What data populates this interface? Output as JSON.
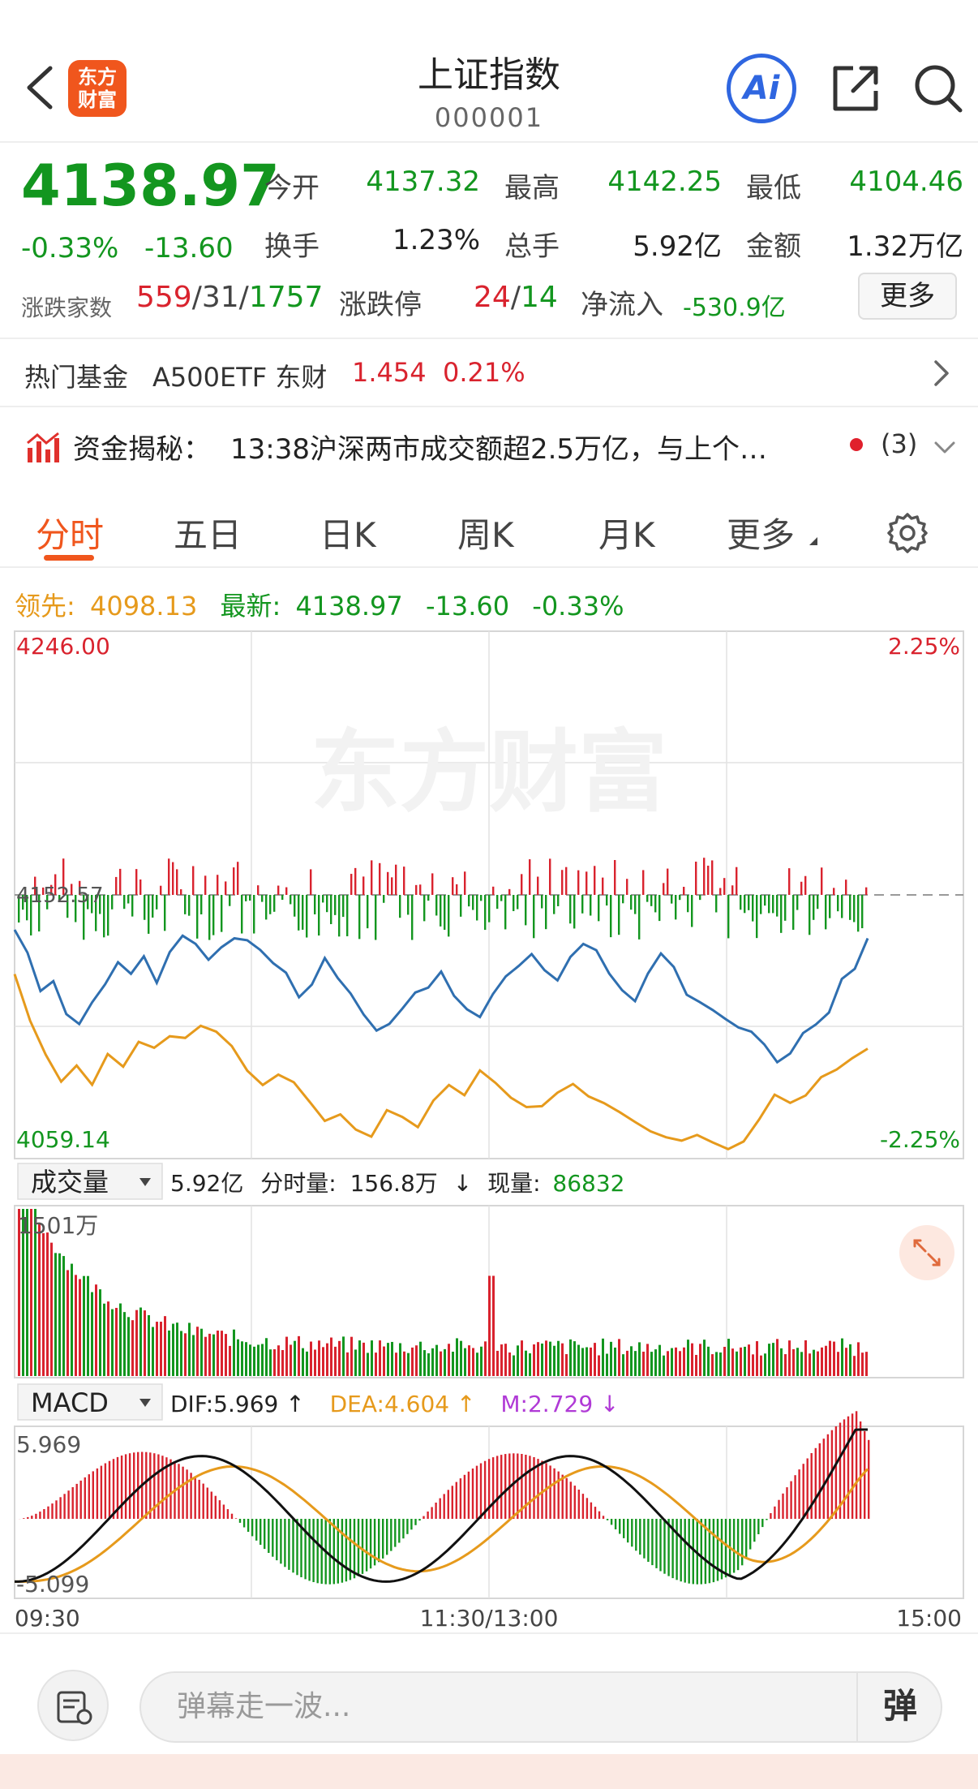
{
  "header": {
    "title": "上证指数",
    "code": "000001",
    "logo_text": "东方财富",
    "ai_label": "Ai"
  },
  "quote": {
    "price": "4138.97",
    "change_pct": "-0.33%",
    "change": "-13.60",
    "open_label": "今开",
    "open": "4137.32",
    "high_label": "最高",
    "high": "4142.25",
    "low_label": "最低",
    "low": "4104.46",
    "turnover_label": "换手",
    "turnover": "1.23%",
    "volume_label": "总手",
    "volume": "5.92亿",
    "amount_label": "金额",
    "amount": "1.32万亿",
    "breadth_label": "涨跌家数",
    "breadth_up": "559",
    "breadth_flat": "31",
    "breadth_down": "1757",
    "limit_label": "涨跌停",
    "limit_up": "24",
    "limit_down": "14",
    "netflow_label": "净流入",
    "netflow": "-530.9亿",
    "more_label": "更多"
  },
  "hot_fund": {
    "label": "热门基金",
    "name": "A500ETF 东财",
    "price": "1.454",
    "pct": "0.21%"
  },
  "news": {
    "label": "资金揭秘：",
    "text": "13:38沪深两市成交额超2.5万亿，与上个…",
    "count": "(3)"
  },
  "tabs": [
    "分时",
    "五日",
    "日K",
    "周K",
    "月K",
    "更多"
  ],
  "tab_active": 0,
  "legend": {
    "lead_label": "领先:",
    "lead_value": "4098.13",
    "latest_label": "最新:",
    "latest_value": "4138.97",
    "change": "-13.60",
    "pct": "-0.33%"
  },
  "price_chart": {
    "top_label": "4246.00",
    "mid_label": "4152.57",
    "bottom_label": "4059.14",
    "top_pct": "2.25%",
    "bottom_pct": "-2.25%",
    "watermark": "东方财富"
  },
  "volume_panel": {
    "indicator": "成交量",
    "total": "5.92亿",
    "minute_label": "分时量:",
    "minute_value": "156.8万",
    "minute_arrow": "↓",
    "current_label": "现量:",
    "current_value": "86832",
    "max_label": "1501万"
  },
  "macd_panel": {
    "indicator": "MACD",
    "dif": "DIF:5.969 ↑",
    "dea": "DEA:4.604 ↑",
    "m": "M:2.729 ↓",
    "top_label": "5.969",
    "bottom_label": "-5.099"
  },
  "time_axis": {
    "start": "09:30",
    "mid": "11:30/13:00",
    "end": "15:00"
  },
  "bottom_bar": {
    "input_placeholder": "弹幕走一波...",
    "toggle_label": "弹"
  },
  "colors": {
    "up": "#d9232e",
    "down": "#13961f",
    "price_line": "#2f6fb0",
    "lead_line": "#e69a1c",
    "accent": "#f0561d"
  },
  "chart_data": {
    "type": "line",
    "title": "上证指数",
    "x_range": [
      "09:30",
      "15:00"
    ],
    "price": {
      "ylim": [
        4059.14,
        4246.0
      ],
      "prev_close": 4152.57,
      "series": [
        {
          "name": "最新",
          "values": [
            4140.2,
            4132.1,
            4118.5,
            4122.0,
            4110.3,
            4106.8,
            4114.5,
            4120.9,
            4128.7,
            4124.6,
            4130.8,
            4121.4,
            4132.3,
            4138.1,
            4135.2,
            4129.6,
            4134.0,
            4137.2,
            4136.5,
            4133.1,
            4128.4,
            4125.0,
            4116.3,
            4120.8,
            4130.2,
            4123.1,
            4117.6,
            4110.2,
            4104.5,
            4106.9,
            4112.3,
            4118.0,
            4119.7,
            4125.4,
            4116.8,
            4112.0,
            4109.3,
            4117.4,
            4123.7,
            4127.4,
            4131.6,
            4125.9,
            4122.3,
            4130.6,
            4135.2,
            4133.0,
            4124.7,
            4118.8,
            4114.9,
            4124.7,
            4131.8,
            4127.0,
            4117.2,
            4114.6,
            4111.8,
            4108.6,
            4105.6,
            4104.1,
            4099.6,
            4093.3,
            4096.4,
            4103.6,
            4106.7,
            4110.9,
            4122.8,
            4126.4,
            4137.2
          ]
        },
        {
          "name": "领先",
          "values": [
            4124.5,
            4108.0,
            4096.0,
            4086.4,
            4092.1,
            4085.3,
            4096.2,
            4091.7,
            4100.5,
            4098.4,
            4102.5,
            4101.9,
            4106.2,
            4104.1,
            4099.0,
            4090.3,
            4085.2,
            4088.9,
            4086.2,
            4079.4,
            4072.5,
            4074.8,
            4069.4,
            4066.9,
            4076.3,
            4073.9,
            4070.3,
            4079.7,
            4085.2,
            4081.6,
            4090.4,
            4086.0,
            4080.7,
            4077.4,
            4077.7,
            4082.5,
            4085.6,
            4081.2,
            4078.8,
            4075.6,
            4072.1,
            4068.8,
            4066.7,
            4065.5,
            4067.5,
            4064.9,
            4062.5,
            4065.2,
            4073.0,
            4081.8,
            4078.9,
            4081.5,
            4088.0,
            4090.7,
            4094.7,
            4098.1
          ]
        }
      ]
    },
    "volume": {
      "ylim": [
        0,
        1501
      ],
      "unit": "万"
    },
    "macd": {
      "ylim": [
        -5.099,
        5.969
      ],
      "dif": 5.969,
      "dea": 4.604,
      "m": 2.729
    }
  }
}
